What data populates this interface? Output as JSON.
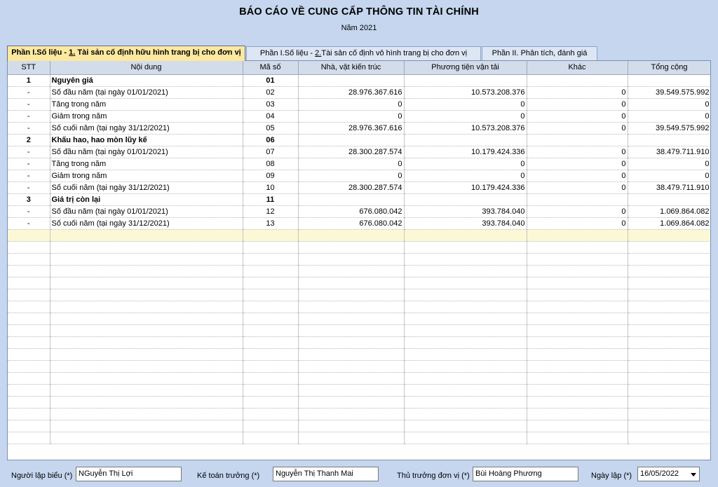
{
  "title": "BÁO CÁO VỀ CUNG CẤP THÔNG TIN TÀI CHÍNH",
  "year": "Năm 2021",
  "tabs": [
    {
      "prefix": "Phần I.Số liệu - ",
      "underline": "1.",
      "suffix": " Tài sản cố định hữu hình trang bị cho đơn vị",
      "active": true
    },
    {
      "prefix": "Phần I.Số liệu - ",
      "underline": "2.",
      "suffix": "Tài sản cố định vô hình trang bị cho đơn vị",
      "active": false
    },
    {
      "prefix": "Phần II. Phân tích, đánh giá",
      "underline": "",
      "suffix": "",
      "active": false
    }
  ],
  "columns": [
    "STT",
    "Nội dung",
    "Mã số",
    "Nhà, vật kiến trúc",
    "Phương tiện vận tải",
    "Khác",
    "Tổng cộng"
  ],
  "rows": [
    {
      "stt": "1",
      "content": "Nguyên giá",
      "code": "01",
      "house": "",
      "transport": "",
      "other": "",
      "total": "",
      "group": true
    },
    {
      "stt": "-",
      "content": "Số đầu năm (tại ngày 01/01/2021)",
      "code": "02",
      "house": "28.976.367.616",
      "transport": "10.573.208.376",
      "other": "0",
      "total": "39.549.575.992"
    },
    {
      "stt": "-",
      "content": "Tăng trong năm",
      "code": "03",
      "house": "0",
      "transport": "0",
      "other": "0",
      "total": "0"
    },
    {
      "stt": "-",
      "content": "Giảm trong năm",
      "code": "04",
      "house": "0",
      "transport": "0",
      "other": "0",
      "total": "0"
    },
    {
      "stt": "-",
      "content": "Số cuối năm (tại ngày 31/12/2021)",
      "code": "05",
      "house": "28.976.367.616",
      "transport": "10.573.208.376",
      "other": "0",
      "total": "39.549.575.992"
    },
    {
      "stt": "2",
      "content": "Khấu hao, hao mòn lũy kế",
      "code": "06",
      "house": "",
      "transport": "",
      "other": "",
      "total": "",
      "group": true
    },
    {
      "stt": "-",
      "content": "Số đầu năm (tại ngày 01/01/2021)",
      "code": "07",
      "house": "28.300.287.574",
      "transport": "10.179.424.336",
      "other": "0",
      "total": "38.479.711.910"
    },
    {
      "stt": "-",
      "content": "Tăng trong năm",
      "code": "08",
      "house": "0",
      "transport": "0",
      "other": "0",
      "total": "0"
    },
    {
      "stt": "-",
      "content": "Giảm trong năm",
      "code": "09",
      "house": "0",
      "transport": "0",
      "other": "0",
      "total": "0"
    },
    {
      "stt": "-",
      "content": "Số cuối năm (tại ngày 31/12/2021)",
      "code": "10",
      "house": "28.300.287.574",
      "transport": "10.179.424.336",
      "other": "0",
      "total": "38.479.711.910"
    },
    {
      "stt": "3",
      "content": "Giá trị còn lại",
      "code": "11",
      "house": "",
      "transport": "",
      "other": "",
      "total": "",
      "group": true
    },
    {
      "stt": "-",
      "content": "Số đầu năm (tại ngày 01/01/2021)",
      "code": "12",
      "house": "676.080.042",
      "transport": "393.784.040",
      "other": "0",
      "total": "1.069.864.082"
    },
    {
      "stt": "-",
      "content": "Số cuối năm (tại ngày 31/12/2021)",
      "code": "13",
      "house": "676.080.042",
      "transport": "393.784.040",
      "other": "0",
      "total": "1.069.864.082"
    }
  ],
  "footer": {
    "preparer_label": "Người lập biểu (*)",
    "preparer_value": "NGuyễn Thị Lợi",
    "accountant_label": "Kế toán trưởng (*)",
    "accountant_value": "Nguyễn Thị Thanh Mai",
    "head_label": "Thủ trưởng đơn vị (*)",
    "head_value": "Bùi Hoàng Phương",
    "date_label": "Ngày lập (*)",
    "date_value": "16/05/2022"
  },
  "colors": {
    "background": "#c5d6ee",
    "active_tab": "#fde8a0",
    "highlight_row": "#fbf8d5",
    "header": "#d3dcea"
  }
}
